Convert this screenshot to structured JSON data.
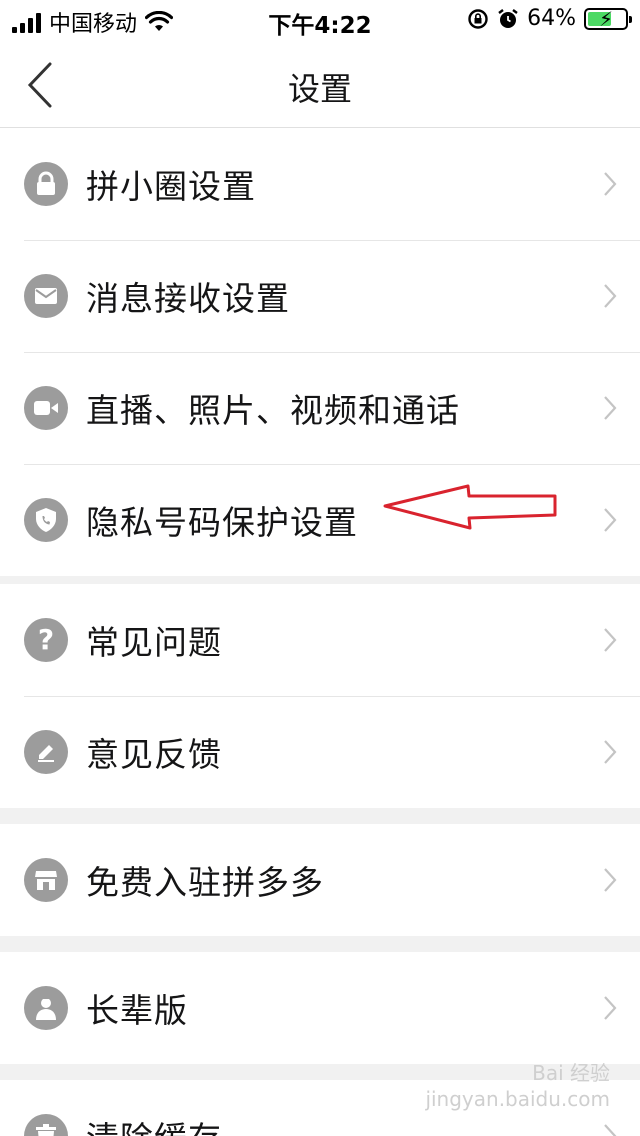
{
  "status_bar": {
    "carrier": "中国移动",
    "time": "下午4:22",
    "battery": "64%"
  },
  "nav": {
    "title": "设置"
  },
  "groups": [
    {
      "items": [
        {
          "label": "拼小圈设置",
          "icon": "lock-icon"
        },
        {
          "label": "消息接收设置",
          "icon": "mail-icon"
        },
        {
          "label": "直播、照片、视频和通话",
          "icon": "video-camera-icon"
        },
        {
          "label": "隐私号码保护设置",
          "icon": "shield-phone-icon"
        }
      ]
    },
    {
      "items": [
        {
          "label": "常见问题",
          "icon": "question-icon"
        },
        {
          "label": "意见反馈",
          "icon": "pencil-icon"
        }
      ]
    },
    {
      "items": [
        {
          "label": "免费入驻拼多多",
          "icon": "store-icon"
        }
      ]
    },
    {
      "items": [
        {
          "label": "长辈版",
          "icon": "elder-icon"
        }
      ]
    },
    {
      "items": [
        {
          "label": "清除缓存",
          "icon": "trash-icon"
        }
      ]
    }
  ],
  "annotation": {
    "color": "#d9232e"
  },
  "watermark": {
    "line1": "Bai 经验",
    "line2": "jingyan.baidu.com"
  },
  "colors": {
    "icon_bg": "#9c9c9c",
    "background": "#f1f1f1",
    "text": "#151516"
  }
}
